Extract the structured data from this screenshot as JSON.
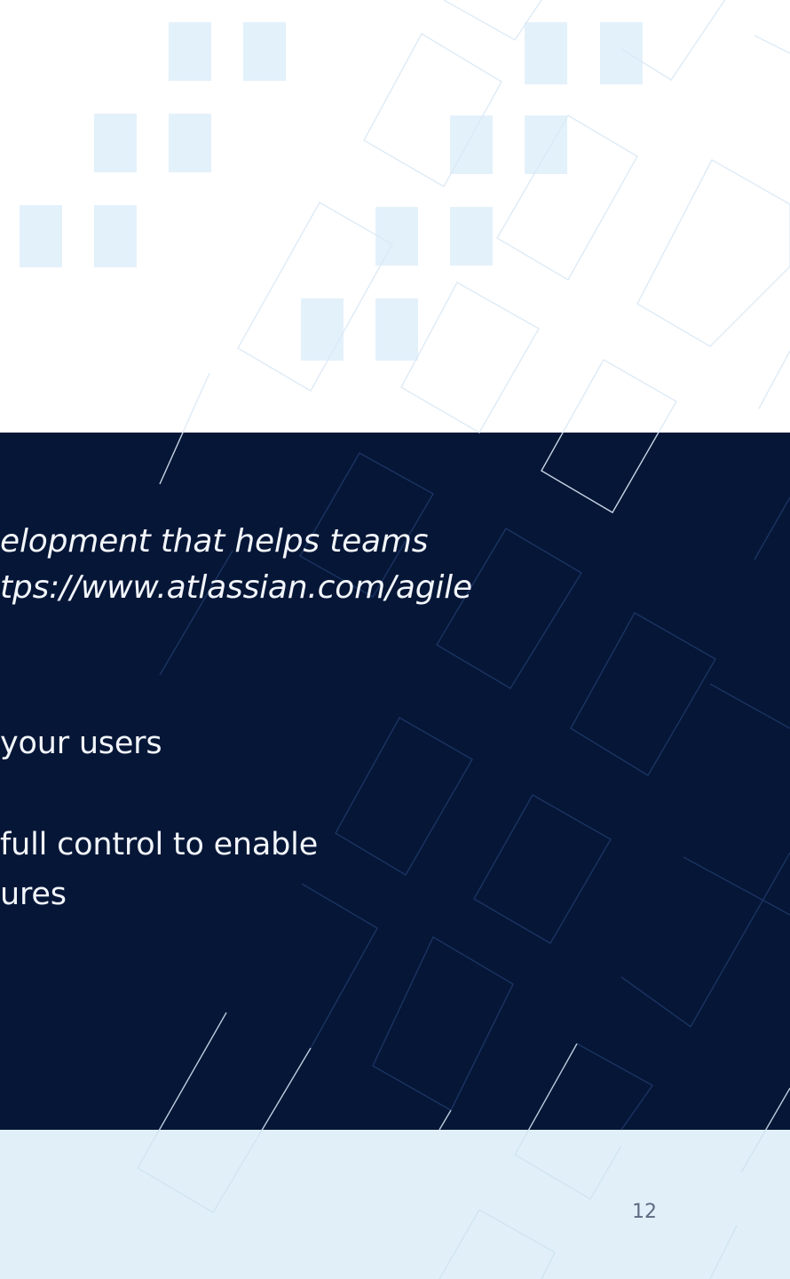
{
  "quote": {
    "line1": "elopment that helps teams",
    "line2": "tps://www.atlassian.com/agile"
  },
  "bullets": [
    {
      "lines": [
        "your users"
      ]
    },
    {
      "lines": [
        "full control to enable",
        "ures"
      ]
    }
  ],
  "footer": {
    "page_number": "12"
  },
  "colors": {
    "band": "#061637",
    "footer_bg": "#e1f0f8",
    "square": "#e3f1fb"
  }
}
